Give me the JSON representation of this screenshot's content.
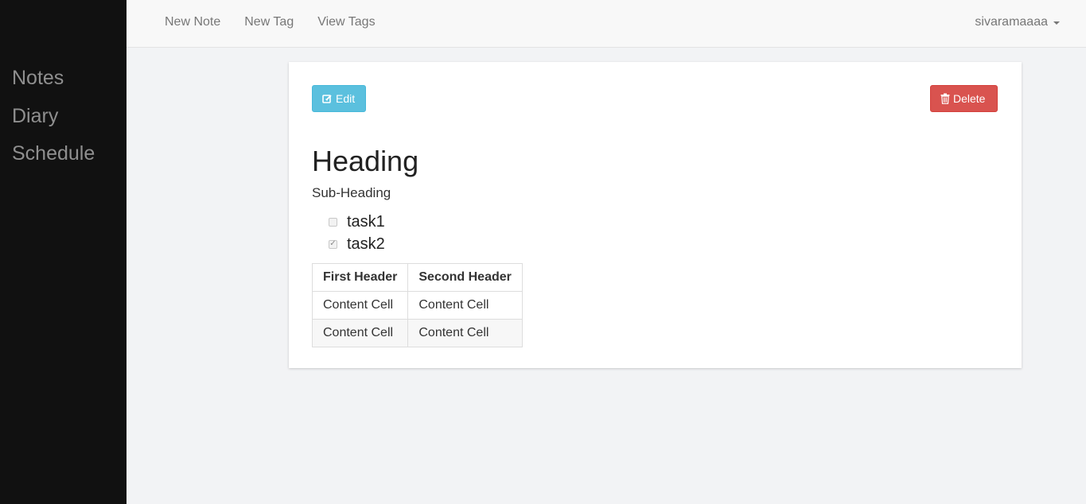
{
  "sidebar": {
    "items": [
      {
        "label": "Notes"
      },
      {
        "label": "Diary"
      },
      {
        "label": "Schedule"
      }
    ]
  },
  "topbar": {
    "links": [
      {
        "label": "New Note"
      },
      {
        "label": "New Tag"
      },
      {
        "label": "View Tags"
      }
    ],
    "user": "sivaramaaaa"
  },
  "note": {
    "edit_label": "Edit",
    "delete_label": "Delete",
    "heading": "Heading",
    "subheading": "Sub-Heading",
    "tasks": [
      {
        "label": "task1",
        "checked": false
      },
      {
        "label": "task2",
        "checked": true
      }
    ],
    "table": {
      "headers": [
        "First Header",
        "Second Header"
      ],
      "rows": [
        [
          "Content Cell",
          "Content Cell"
        ],
        [
          "Content Cell",
          "Content Cell"
        ]
      ]
    }
  },
  "colors": {
    "sidebar_bg": "#111111",
    "edit_button": "#5bc0de",
    "delete_button": "#d9534f"
  }
}
